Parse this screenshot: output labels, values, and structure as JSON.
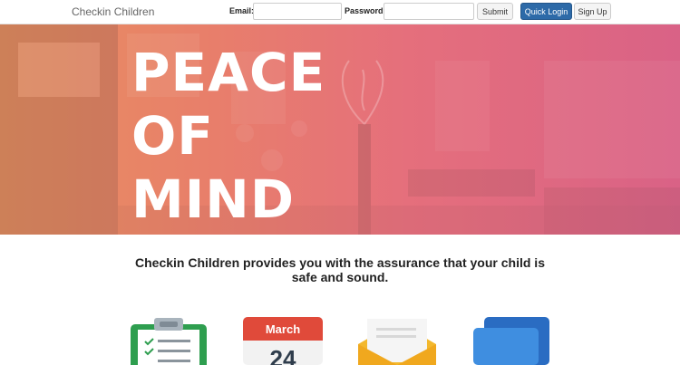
{
  "navbar": {
    "brand": "Checkin Children",
    "email_label": "Email:",
    "email_value": "",
    "password_label": "Password:",
    "password_value": "",
    "submit_label": "Submit",
    "quick_login_label": "Quick Login",
    "signup_label": "Sign Up"
  },
  "hero": {
    "title_lines": [
      "PEACE",
      "OF",
      "MIND"
    ]
  },
  "tagline": {
    "line1": "Checkin Children provides you with the assurance that your child is",
    "line2": "safe and sound."
  },
  "features": {
    "calendar_month": "March",
    "calendar_day": "24"
  },
  "colors": {
    "primary_button": "#2d6aa8",
    "hero_left": "#e8905f",
    "hero_right": "#d96286"
  }
}
